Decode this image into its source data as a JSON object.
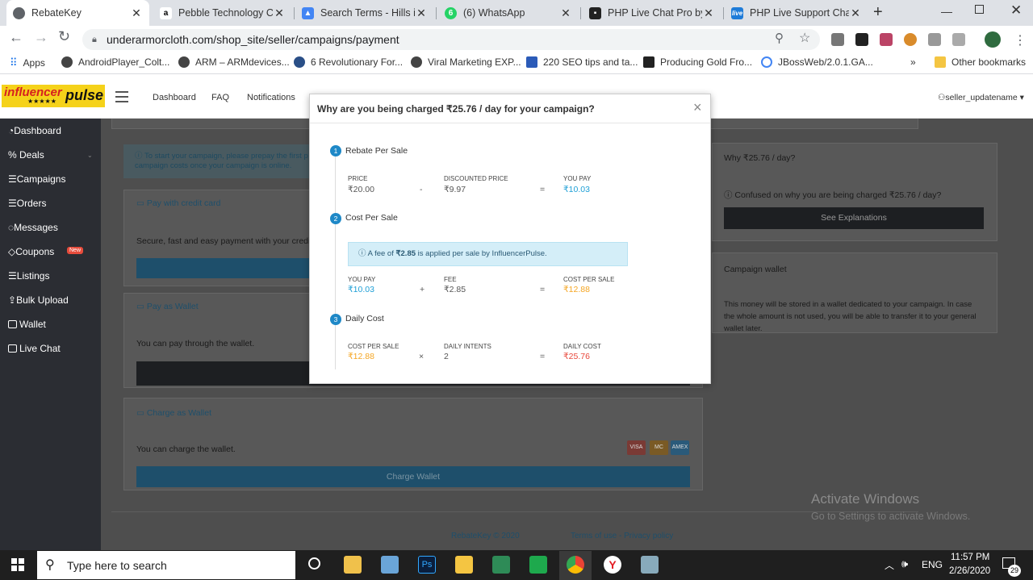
{
  "browser": {
    "tabs": [
      {
        "title": "RebateKey",
        "color": "#5f6368"
      },
      {
        "title": "Pebble Technology Cor",
        "color": "#f2f2f2"
      },
      {
        "title": "Search Terms - Hills inte",
        "color": "#4285f4"
      },
      {
        "title": "(6) WhatsApp",
        "color": "#25d366"
      },
      {
        "title": "PHP Live Chat Pro by m",
        "color": "#222222"
      },
      {
        "title": "PHP Live Support Chat",
        "color": "#1e7bd8"
      }
    ],
    "new_tab": "+",
    "url": "underarmorcloth.com/shop_site/seller/campaigns/payment",
    "bookmarks": [
      "Apps",
      "AndroidPlayer_Colt...",
      "ARM – ARMdevices...",
      "6 Revolutionary For...",
      "Viral Marketing EXP...",
      "220 SEO tips and ta...",
      "Producing Gold Fro...",
      "JBossWeb/2.0.1.GA..."
    ],
    "bookmarks_more": "»",
    "other_bookmarks": "Other bookmarks"
  },
  "header": {
    "logo_top": "influencer",
    "logo_bottom": "pulse",
    "logo_stars": "★★★★★",
    "nav": [
      "Dashboard",
      "FAQ",
      "Notifications"
    ],
    "user": "seller_updatename"
  },
  "sidebar": {
    "items": [
      "Dashboard",
      "Deals",
      "Campaigns",
      "Orders",
      "Messages",
      "Coupons",
      "Listings",
      "Bulk Upload",
      "Wallet",
      "Live Chat"
    ],
    "new_badge": "New"
  },
  "page": {
    "info_line1": "ⓘ To start your campaign, please prepay the first p",
    "info_line2": "campaign costs once your campaign is online.",
    "credit_title": "Pay with credit card",
    "credit_desc": "Secure, fast and easy payment with your credit/de",
    "wallet_title": "Pay as Wallet",
    "wallet_desc": "You can pay through the wallet.",
    "charge_title": "Charge as Wallet",
    "charge_desc": "You can charge the wallet.",
    "charge_button": "Charge Wallet",
    "card_brands": [
      "VISA",
      "MC",
      "AMEX"
    ],
    "why_title": "Why ₹25.76 / day?",
    "why_text": "ⓘ Confused on why you are being charged ₹25.76 / day?",
    "see_button": "See Explanations",
    "wallet_panel_title": "Campaign wallet",
    "wallet_panel_text1": "This money will be stored in a wallet dedicated to your campaign. In case",
    "wallet_panel_text2": "the whole amount is not used, you will be able to transfer it to your general",
    "wallet_panel_text3": "wallet later.",
    "footer_brand": "RebateKey © 2020",
    "footer_links": "Terms of use - Privacy policy",
    "watermark1": "Activate Windows",
    "watermark2": "Go to Settings to activate Windows."
  },
  "modal": {
    "title": "Why are you being charged ₹25.76 / day for your campaign?",
    "close": "×",
    "s1": {
      "num": "1",
      "title": "Rebate Per Sale",
      "l1": "PRICE",
      "v1": "₹20.00",
      "op1": "-",
      "l2": "DISCOUNTED PRICE",
      "v2": "₹9.97",
      "op2": "=",
      "l3": "YOU PAY",
      "v3": "₹10.03"
    },
    "s2": {
      "num": "2",
      "title": "Cost Per Sale",
      "info_pre": "ⓘ A fee of ",
      "info_bold": "₹2.85",
      "info_post": " is applied per sale by InfluencerPulse.",
      "l1": "YOU PAY",
      "v1": "₹10.03",
      "op1": "+",
      "l2": "FEE",
      "v2": "₹2.85",
      "op2": "=",
      "l3": "COST PER SALE",
      "v3": "₹12.88"
    },
    "s3": {
      "num": "3",
      "title": "Daily Cost",
      "l1": "COST PER SALE",
      "v1": "₹12.88",
      "op1": "×",
      "l2": "DAILY INTENTS",
      "v2": "2",
      "op2": "=",
      "l3": "DAILY COST",
      "v3": "₹25.76"
    },
    "colors": {
      "blue": "#1e9fd6",
      "orange": "#f5a623",
      "red": "#e8473b"
    }
  },
  "taskbar": {
    "search_placeholder": "Type here to search",
    "lang": "ENG",
    "time": "11:57 PM",
    "date": "2/26/2020",
    "notif": "29"
  }
}
